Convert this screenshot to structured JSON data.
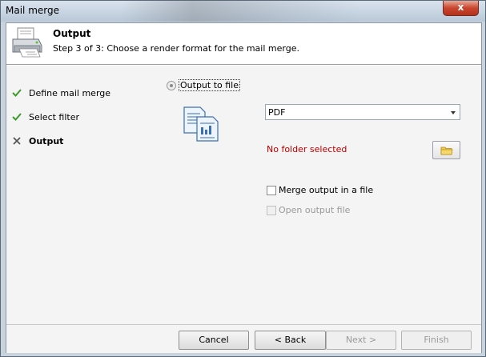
{
  "window": {
    "title": "Mail merge",
    "close_label": "x"
  },
  "header": {
    "title": "Output",
    "subtitle": "Step 3 of 3: Choose a render format for the mail merge."
  },
  "steps": [
    {
      "label": "Define mail merge",
      "state": "done"
    },
    {
      "label": "Select filter",
      "state": "done"
    },
    {
      "label": "Output",
      "state": "current"
    }
  ],
  "output": {
    "radio_label": "Output to file",
    "format_value": "PDF",
    "folder_status": "No folder selected",
    "merge_label": "Merge output in a file",
    "open_label": "Open output file"
  },
  "footer": {
    "cancel": "Cancel",
    "back": "< Back",
    "next": "Next >",
    "finish": "Finish"
  },
  "colors": {
    "error": "#c00000",
    "check_green": "#3a9a2a"
  }
}
